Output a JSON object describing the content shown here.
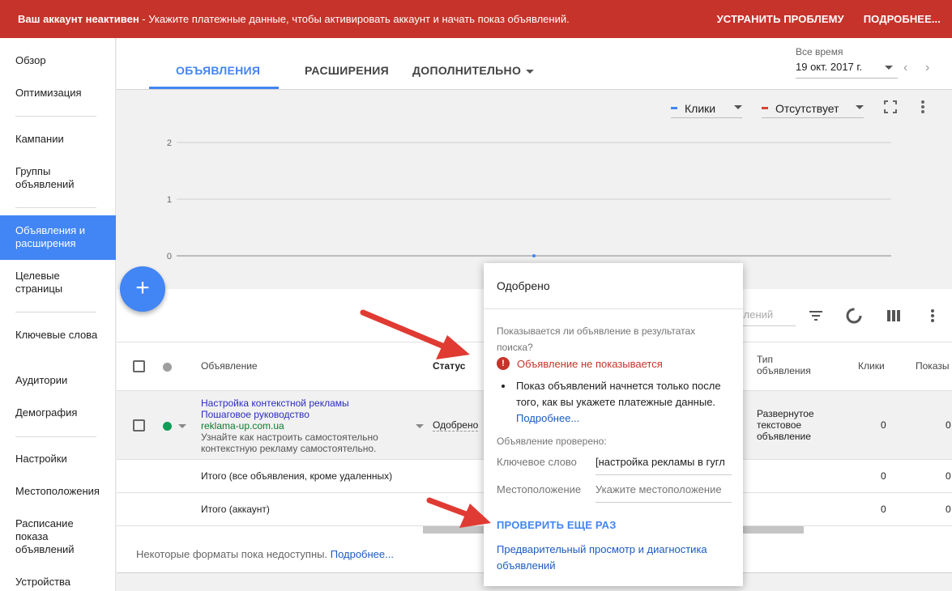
{
  "banner": {
    "bold": "Ваш аккаунт неактивен",
    "text": " - Укажите платежные данные, чтобы активировать аккаунт и начать показ объявлений.",
    "fix_button": "УСТРАНИТЬ ПРОБЛЕМУ",
    "details_button": "ПОДРОБНЕЕ..."
  },
  "sidebar": {
    "items": [
      {
        "label": "Обзор"
      },
      {
        "label": "Оптимизация"
      },
      {
        "label": "Кампании"
      },
      {
        "label": "Группы объявлений"
      },
      {
        "label": "Объявления и расширения",
        "active": true
      },
      {
        "label": "Целевые страницы"
      },
      {
        "label": "Ключевые слова"
      },
      {
        "label": "Аудитории"
      },
      {
        "label": "Демография"
      },
      {
        "label": "Настройки"
      },
      {
        "label": "Местоположения"
      },
      {
        "label": "Расписание показа объявлений"
      },
      {
        "label": "Устройства"
      }
    ]
  },
  "tabs": [
    {
      "label": "ОБЪЯВЛЕНИЯ",
      "active": true
    },
    {
      "label": "РАСШИРЕНИЯ"
    },
    {
      "label": "ДОПОЛНИТЕЛЬНО"
    }
  ],
  "date": {
    "label": "Все время",
    "value": "19 окт. 2017 г."
  },
  "chart": {
    "metric1": "Клики",
    "metric1_color": "#4285f4",
    "metric2": "Отсутствует",
    "metric2_color": "#db4437"
  },
  "chart_data": {
    "type": "line",
    "ylim": [
      0,
      2
    ],
    "yticks": [
      "2",
      "1",
      "0"
    ],
    "series": [
      {
        "name": "Клики",
        "values": [
          0
        ]
      }
    ]
  },
  "table": {
    "search_placeholder": "явлений",
    "headers": {
      "ad": "Объявление",
      "status": "Статус",
      "type": "Тип объявления",
      "clicks": "Клики",
      "impr": "Показы"
    },
    "row": {
      "title1": "Настройка контекстной рекламы",
      "title2": "Пошаговое руководство",
      "url": "reklama-up.com.ua",
      "description": "Узнайте как настроить самостоятельно контекстную рекламу самостоятельно.",
      "status": "Одобрено",
      "type": "Развернутое текстовое объявление",
      "clicks": "0",
      "impr": "0"
    },
    "totals": [
      {
        "label": "Итого (все объявления, кроме удаленных)",
        "clicks": "0",
        "impr": "0"
      },
      {
        "label": "Итого (аккаунт)",
        "clicks": "0",
        "impr": "0"
      }
    ],
    "footnote": "Некоторые форматы пока недоступны. ",
    "footnote_link": "Подробнее..."
  },
  "popup": {
    "title": "Одобрено",
    "question": "Показывается ли объявление в результатах поиска?",
    "error": "Объявление не показывается",
    "bullet": "Показ объявлений начнется только после того, как вы укажете платежные данные.",
    "bullet_link": "Подробнее...",
    "checked_label": "Объявление проверено:",
    "keyword_label": "Ключевое слово",
    "keyword_value": "[настройка рекламы в гугл",
    "location_label": "Местоположение",
    "location_placeholder": "Укажите местоположение",
    "retry": "ПРОВЕРИТЬ ЕЩЕ РАЗ",
    "preview": "Предварительный просмотр и диагностика объявлений"
  }
}
